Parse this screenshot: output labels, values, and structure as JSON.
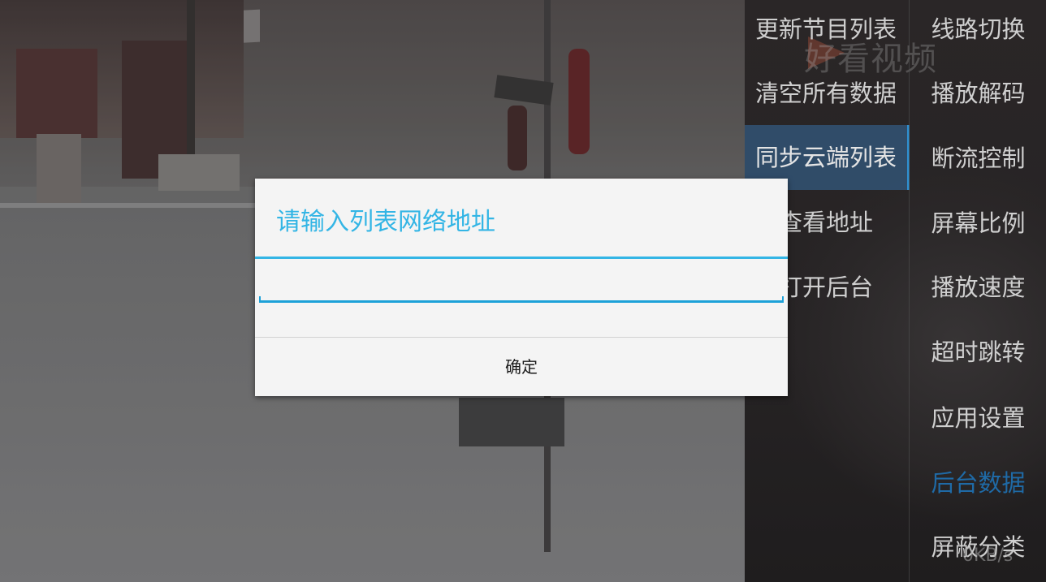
{
  "dialog": {
    "title": "请输入列表网络地址",
    "input_value": "",
    "confirm_label": "确定"
  },
  "menu_left": {
    "items": [
      {
        "label": "更新节目列表"
      },
      {
        "label": "清空所有数据"
      },
      {
        "label": "同步云端列表"
      },
      {
        "label": "查看地址"
      },
      {
        "label": "打开后台"
      }
    ],
    "active_index": 2
  },
  "menu_right": {
    "items": [
      {
        "label": "线路切换"
      },
      {
        "label": "播放解码"
      },
      {
        "label": "断流控制"
      },
      {
        "label": "屏幕比例"
      },
      {
        "label": "播放速度"
      },
      {
        "label": "超时跳转"
      },
      {
        "label": "应用设置"
      },
      {
        "label": "后台数据"
      },
      {
        "label": "屏蔽分类"
      }
    ],
    "active_index": 7
  },
  "watermark": "好看视频",
  "speed_text": "0KB/s",
  "colors": {
    "accent": "#33b5e5",
    "active_right": "#1f6aa6",
    "dialog_bg": "#f4f4f4"
  }
}
